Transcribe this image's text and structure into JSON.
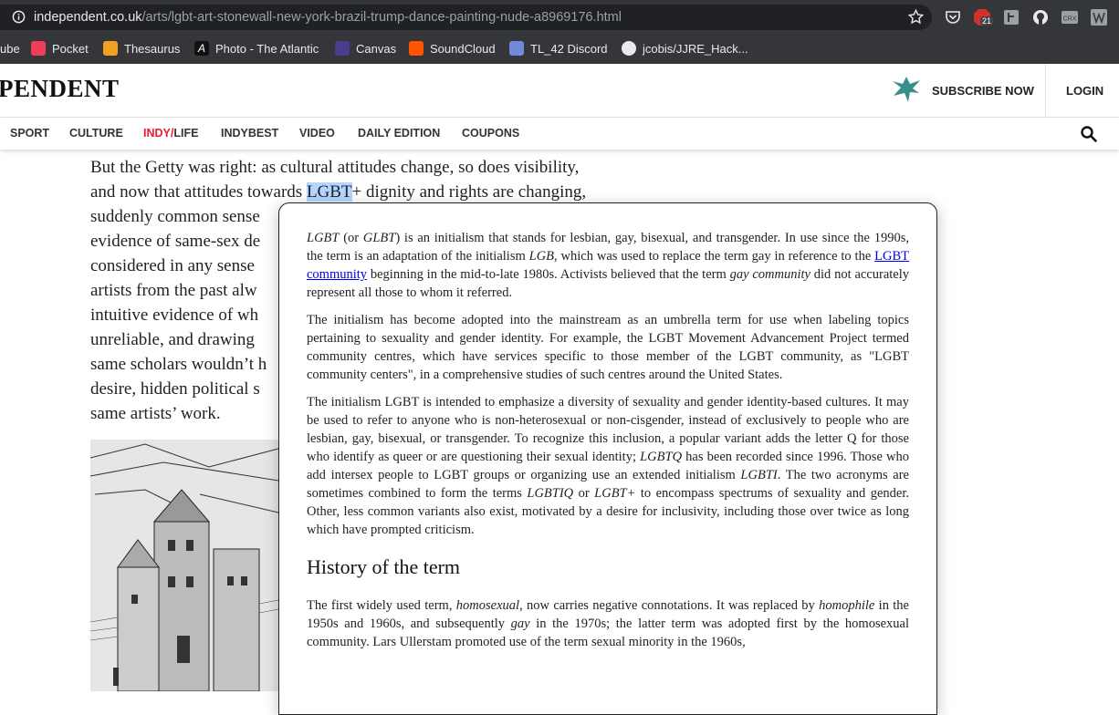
{
  "browser": {
    "url_domain": "independent.co.uk",
    "url_path": "/arts/lgbt-art-stonewall-new-york-brazil-trump-dance-painting-nude-a8969176.html",
    "extensions": [
      "pocket-ext-icon",
      "adblock-ext-icon",
      "reader-ext-icon",
      "github-ext-icon",
      "crx-ext-icon",
      "wiki-ext-icon"
    ],
    "adblock_badge": "21",
    "bookmarks": [
      {
        "label": "ube",
        "icon": "youtube-icon",
        "color": "#ff0000"
      },
      {
        "label": "Pocket",
        "icon": "pocket-icon",
        "color": "#ef3f56"
      },
      {
        "label": "Thesaurus",
        "icon": "thesaurus-icon",
        "color": "#f2a123"
      },
      {
        "label": "Photo - The Atlantic",
        "icon": "atlantic-icon",
        "color": "#111111"
      },
      {
        "label": "Canvas",
        "icon": "canvas-icon",
        "color": "#4a3d8f"
      },
      {
        "label": "SoundCloud",
        "icon": "soundcloud-icon",
        "color": "#ff5500"
      },
      {
        "label": "TL_42 Discord",
        "icon": "discord-icon",
        "color": "#7289da"
      },
      {
        "label": "jcobis/JJRE_Hack...",
        "icon": "github-icon",
        "color": "#111111"
      }
    ]
  },
  "site": {
    "logo": "PENDENT",
    "subscribe": "SUBSCRIBE NOW",
    "login": "LOGIN",
    "nav": [
      {
        "label": "SPORT"
      },
      {
        "label": "CULTURE"
      },
      {
        "label_red": "INDY",
        "label_sep": "/",
        "label": "LIFE"
      },
      {
        "label": "INDYBEST"
      },
      {
        "label": "VIDEO"
      },
      {
        "label": "DAILY EDITION"
      },
      {
        "label": "COUPONS"
      }
    ]
  },
  "article": {
    "l1": "But the Getty was right: as cultural attitudes change, so does visibility,",
    "l2_pre": "and now that attitudes towards ",
    "l2_hl": "LGBT",
    "l2_post": "+ dignity and rights are changing,",
    "l3": "suddenly common sense",
    "l4": "evidence of same-sex de",
    "l5": "considered in any sense",
    "l6": "artists from the past alw",
    "l7": "intuitive evidence of wh",
    "l8": "unreliable, and drawing",
    "l9": "same scholars wouldn’t h",
    "l10": "desire, hidden political s",
    "l11": "same artists’ work."
  },
  "popup": {
    "p1_a": "LGBT",
    "p1_b": " (or ",
    "p1_c": "GLBT",
    "p1_d": ") is an initialism that stands for lesbian, gay, bisexual, and transgender. In use since the 1990s, the term is an adaptation of the initialism ",
    "p1_e": "LGB",
    "p1_f": ", which was used to replace the term gay in reference to the ",
    "p1_link": "LGBT community",
    "p1_g": " beginning in the mid-to-late 1980s. Activists believed that the term ",
    "p1_h": "gay community",
    "p1_i": " did not accurately represent all those to whom it referred.",
    "p2": "The initialism has become adopted into the mainstream as an umbrella term for use when labeling topics pertaining to sexuality and gender identity. For example, the LGBT Movement Advancement Project termed community centres, which have services specific to those member of the LGBT community, as \"LGBT community centers\", in a comprehensive studies of such centres around the United States.",
    "p3_a": "The initialism LGBT is intended to emphasize a diversity of sexuality and gender identity-based cultures. It may be used to refer to anyone who is non-heterosexual or non-cisgender, instead of exclusively to people who are lesbian, gay, bisexual, or transgender. To recognize this inclusion, a popular variant adds the letter Q for those who identify as queer or are questioning their sexual identity; ",
    "p3_b": "LGBTQ",
    "p3_c": " has been recorded since 1996. Those who add intersex people to LGBT groups or organizing use an extended initialism ",
    "p3_d": "LGBTI",
    "p3_e": ". The two acronyms are sometimes combined to form the terms ",
    "p3_f": "LGBTIQ",
    "p3_g": " or ",
    "p3_h": "LGBT+",
    "p3_i": " to encompass spectrums of sexuality and gender. Other, less common variants also exist, motivated by a desire for inclusivity, including those over twice as long which have prompted criticism.",
    "heading": "History of the term",
    "p4_a": "The first widely used term, ",
    "p4_b": "homosexual",
    "p4_c": ", now carries negative connotations. It was replaced by ",
    "p4_d": "homophile",
    "p4_e": " in the 1950s and 1960s, and subsequently ",
    "p4_f": "gay",
    "p4_g": " in the 1970s; the latter term was adopted first by the homosexual community. Lars Ullerstam promoted use of the term sexual minority in the 1960s,"
  }
}
